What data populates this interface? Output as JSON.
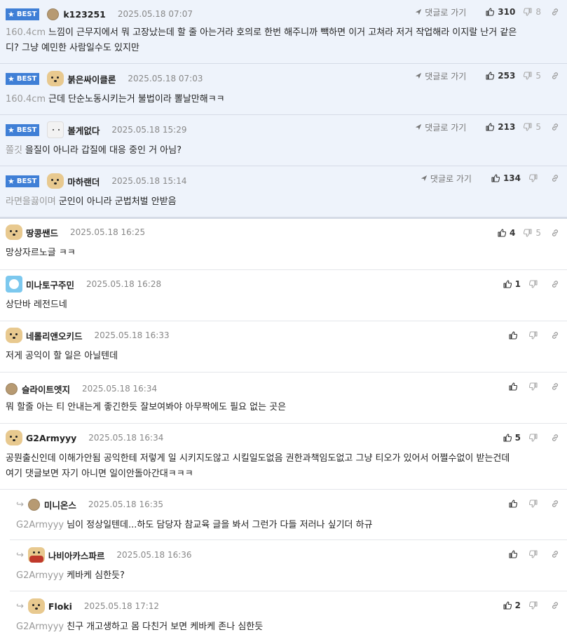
{
  "goto_label": "댓글로 가기",
  "best_label": "BEST",
  "comments": [
    {
      "nick": "k123251",
      "date": "2025.05.18 07:07",
      "up": "310",
      "down": "8",
      "ref": "160.4cm",
      "text": "느낌이 근무지에서 뭐 고장났는데 할 줄 아는거라 호의로 한번 해주니까 빽하면 이거 고쳐라 저거 작업해라 이지랄 난거 같은",
      "text2": "디? 그냥 예민한 사람일수도 있지만"
    },
    {
      "nick": "붉은싸이클론",
      "date": "2025.05.18 07:03",
      "up": "253",
      "down": "5",
      "ref": "160.4cm",
      "text": "근데 단순노동시키는거 불법이라 뽈날만해ㅋㅋ"
    },
    {
      "nick": "볼게없다",
      "date": "2025.05.18 15:29",
      "up": "213",
      "down": "5",
      "ref": "쫄깃",
      "text": "을질이 아니라 갑질에 대응 중인 거 아님?"
    },
    {
      "nick": "마하랜더",
      "date": "2025.05.18 15:14",
      "up": "134",
      "down": "",
      "ref": "라면을끓이며",
      "text": "군인이 아니라 군법처벌 안받음"
    },
    {
      "nick": "땅콩쌘드",
      "date": "2025.05.18 16:25",
      "up": "4",
      "down": "5",
      "text": "망상자르노글 ㅋㅋ"
    },
    {
      "nick": "미나토구주민",
      "date": "2025.05.18 16:28",
      "up": "1",
      "down": "",
      "text": "상단바 레전드네"
    },
    {
      "nick": "네롤리앤오키드",
      "date": "2025.05.18 16:33",
      "up": "",
      "down": "",
      "text": "저게 공익이 할 일은 아닐텐데"
    },
    {
      "nick": "슬라이트엣지",
      "date": "2025.05.18 16:34",
      "up": "",
      "down": "",
      "text": "뭐 할줄 아는 티 안내는게 좋긴한듯 잘보여봐야 아무짝에도 필요 없는 곳은"
    },
    {
      "nick": "G2Armyyy",
      "date": "2025.05.18 16:34",
      "up": "5",
      "down": "",
      "text": "공뭔출신인데 이해가안됨 공익한테 저렇게 일 시키지도않고 시킬일도없음 권한과책임도없고 그냥 티오가 있어서 어쩔수없이 받는건데",
      "text2": "여기 댓글보면 자기 아니면 일이안돌아간대ㅋㅋㅋ"
    },
    {
      "nick": "미니온스",
      "date": "2025.05.18 16:35",
      "up": "",
      "down": "",
      "ref": "G2Armyyy",
      "text": "님이 정상일텐데...하도 담당자 참교육 글을 봐서 그런가 다들 저러나 싶기더 하규"
    },
    {
      "nick": "나비아카스파르",
      "date": "2025.05.18 16:36",
      "up": "",
      "down": "",
      "ref": "G2Armyyy",
      "text": "케바케 심한듯?"
    },
    {
      "nick": "Floki",
      "date": "2025.05.18 17:12",
      "up": "2",
      "down": "",
      "ref": "G2Armyyy",
      "text": "친구 개고생하고 몸 다친거 보면 케바케 존나 심한듯"
    }
  ]
}
